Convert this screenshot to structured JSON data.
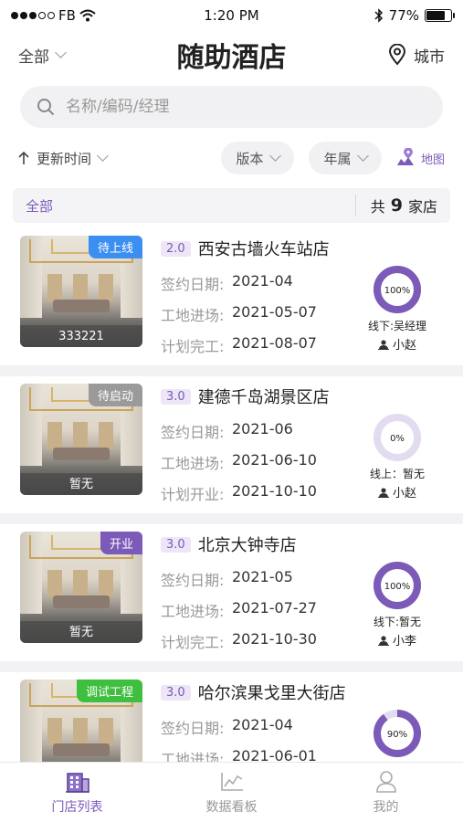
{
  "status_bar": {
    "carrier": "FB",
    "time": "1:20 PM",
    "battery_pct": "77%",
    "battery_level": 0.77
  },
  "header": {
    "filter_label": "全部",
    "title": "随助酒店",
    "city_label": "城市"
  },
  "search": {
    "placeholder": "名称/编码/经理"
  },
  "filters": {
    "sort_label": "更新时间",
    "version_label": "版本",
    "belong_label": "年属",
    "map_label": "地图"
  },
  "summary": {
    "tab_label": "全部",
    "count_prefix": "共",
    "count": "9",
    "count_suffix": "家店"
  },
  "colors": {
    "accent": "#7b5ab8",
    "badge_blue": "#3b8ff0",
    "badge_grey": "#9a9a9a",
    "badge_purple": "#7b5ab8",
    "badge_green": "#3fbf3f",
    "ring_fill": "#7b5ab8",
    "ring_track": "#e3dcf0"
  },
  "stores": [
    {
      "badge": "待上线",
      "badge_color": "#3b8ff0",
      "thumb_caption": "333221",
      "version": "2.0",
      "name": "西安古墙火车站店",
      "rows": [
        {
          "label": "签约日期:",
          "value": "2021-04"
        },
        {
          "label": "工地进场:",
          "value": "2021-05-07"
        },
        {
          "label": "计划完工:",
          "value": "2021-08-07"
        }
      ],
      "progress": 100,
      "progress_label": "100%",
      "manager": "线下:吴经理",
      "staff": "小赵"
    },
    {
      "badge": "待启动",
      "badge_color": "#9a9a9a",
      "thumb_caption": "暂无",
      "version": "3.0",
      "name": "建德千岛湖景区店",
      "rows": [
        {
          "label": "签约日期:",
          "value": "2021-06"
        },
        {
          "label": "工地进场:",
          "value": "2021-06-10"
        },
        {
          "label": "计划开业:",
          "value": "2021-10-10"
        }
      ],
      "progress": 0,
      "progress_label": "0%",
      "manager": "线上：暂无",
      "staff": "小赵"
    },
    {
      "badge": "开业",
      "badge_color": "#7b5ab8",
      "thumb_caption": "暂无",
      "version": "3.0",
      "name": "北京大钟寺店",
      "rows": [
        {
          "label": "签约日期:",
          "value": "2021-05"
        },
        {
          "label": "工地进场:",
          "value": "2021-07-27"
        },
        {
          "label": "计划完工:",
          "value": "2021-10-30"
        }
      ],
      "progress": 100,
      "progress_label": "100%",
      "manager": "线下:暂无",
      "staff": "小李"
    },
    {
      "badge": "调试工程",
      "badge_color": "#3fbf3f",
      "thumb_caption": "",
      "version": "3.0",
      "name": "哈尔滨果戈里大街店",
      "rows": [
        {
          "label": "签约日期:",
          "value": "2021-04"
        },
        {
          "label": "工地进场:",
          "value": "2021-06-01"
        }
      ],
      "progress": 90,
      "progress_label": "90%",
      "manager": "",
      "staff": ""
    }
  ],
  "tabbar": [
    {
      "label": "门店列表",
      "icon": "building-icon",
      "active": true
    },
    {
      "label": "数据看板",
      "icon": "chart-icon",
      "active": false
    },
    {
      "label": "我的",
      "icon": "user-icon",
      "active": false
    }
  ]
}
